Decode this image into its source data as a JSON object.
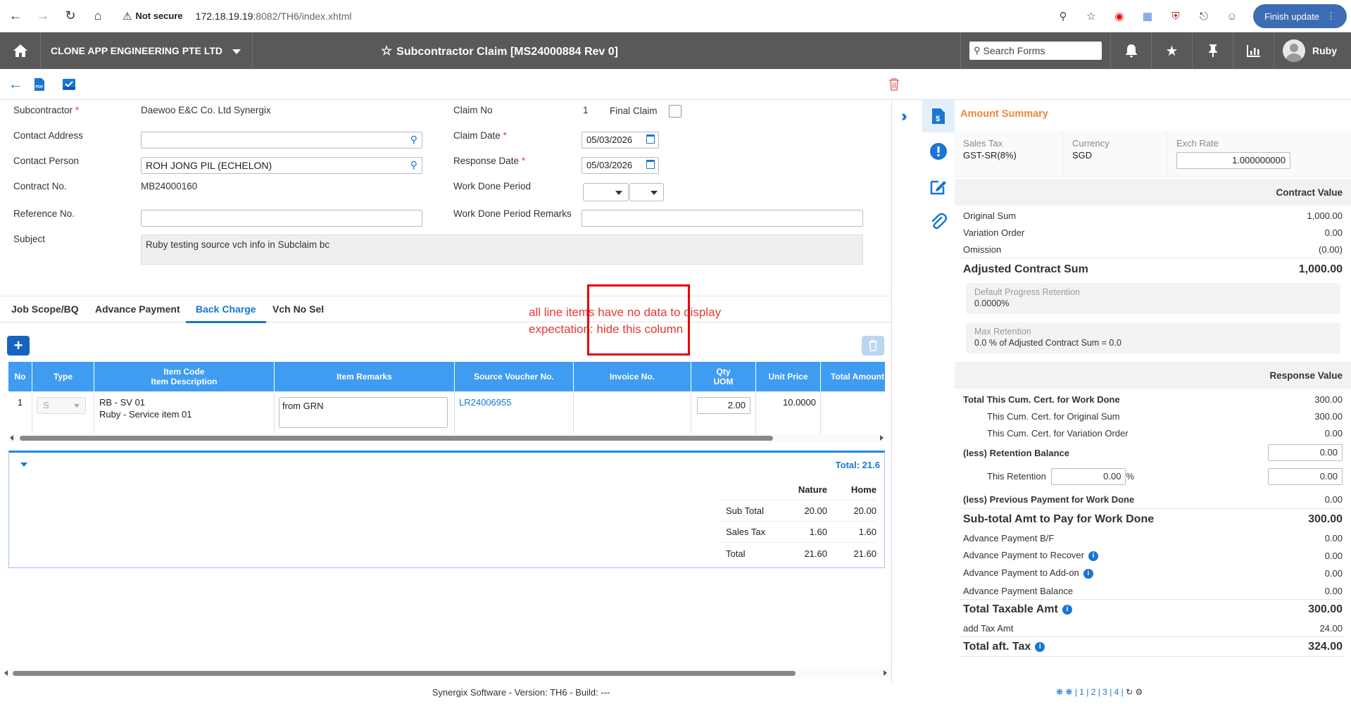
{
  "browser": {
    "security": "Not secure",
    "url_host": "172.18.19.19",
    "url_rest": ":8082/TH6/index.xhtml",
    "finish_update": "Finish update"
  },
  "header": {
    "company": "CLONE APP ENGINEERING PTE LTD",
    "title": "Subcontractor Claim [MS24000884 Rev 0]",
    "search_placeholder": "Search Forms",
    "user": "Ruby"
  },
  "form": {
    "subcontractor_label": "Subcontractor",
    "subcontractor_value": "Daewoo E&C Co. Ltd Synergix",
    "contact_address_label": "Contact Address",
    "contact_address_value": "",
    "contact_person_label": "Contact Person",
    "contact_person_value": "ROH JONG PIL (ECHELON)",
    "contract_no_label": "Contract No.",
    "contract_no_value": "MB24000160",
    "reference_no_label": "Reference No.",
    "reference_no_value": "",
    "subject_label": "Subject",
    "subject_value": "Ruby testing source vch info in Subclaim bc",
    "claim_no_label": "Claim No",
    "claim_no_value": "1",
    "final_claim_label": "Final Claim",
    "claim_date_label": "Claim Date",
    "claim_date_value": "05/03/2026",
    "response_date_label": "Response Date",
    "response_date_value": "05/03/2026",
    "work_done_period_label": "Work Done Period",
    "work_done_remarks_label": "Work Done Period Remarks",
    "required_mark": "*"
  },
  "tabs": [
    {
      "label": "Job Scope/BQ"
    },
    {
      "label": "Advance Payment"
    },
    {
      "label": "Back Charge"
    },
    {
      "label": "Vch No Sel"
    }
  ],
  "annotation": {
    "line1": "all line items have no data to display",
    "line2": "expectation: hide this column"
  },
  "grid": {
    "headers": {
      "no": "No",
      "type": "Type",
      "item_code": "Item Code",
      "item_desc": "Item Description",
      "remarks": "Item Remarks",
      "source_voucher": "Source Voucher No.",
      "invoice": "Invoice No.",
      "qty": "Qty",
      "uom": "UOM",
      "unit_price": "Unit Price",
      "total_amount": "Total Amount"
    },
    "rows": [
      {
        "no": "1",
        "type": "S",
        "item_code": "RB - SV 01",
        "item_desc": "Ruby - Service item 01",
        "remarks": "from GRN",
        "source_voucher": "LR24006955",
        "invoice": "",
        "qty": "2.00",
        "unit_price": "10.0000",
        "total_amount": ""
      }
    ]
  },
  "totals": {
    "total_label": "Total: 21.6",
    "nature_label": "Nature",
    "home_label": "Home",
    "rows": [
      {
        "label": "Sub Total",
        "nature": "20.00",
        "home": "20.00"
      },
      {
        "label": "Sales Tax",
        "nature": "1.60",
        "home": "1.60"
      },
      {
        "label": "Total",
        "nature": "21.60",
        "home": "21.60"
      }
    ]
  },
  "footer": {
    "version": "Synergix Software - Version: TH6 - Build: ---",
    "pages": "| 1 | 2 | 3 | 4 |"
  },
  "summary": {
    "title": "Amount Summary",
    "sales_tax_label": "Sales Tax",
    "sales_tax_value": "GST-SR(8%)",
    "currency_label": "Currency",
    "currency_value": "SGD",
    "exch_rate_label": "Exch Rate",
    "exch_rate_value": "1.000000000",
    "contract_value_head": "Contract Value",
    "original_sum_label": "Original Sum",
    "original_sum_value": "1,000.00",
    "variation_order_label": "Variation Order",
    "variation_order_value": "0.00",
    "omission_label": "Omission",
    "omission_value": "(0.00)",
    "adjusted_label": "Adjusted Contract Sum",
    "adjusted_value": "1,000.00",
    "default_retention_label": "Default Progress Retention",
    "default_retention_value": "0.0000%",
    "max_retention_label": "Max Retention",
    "max_retention_value": "0.0 % of Adjusted Contract Sum = 0.0",
    "response_value_head": "Response Value",
    "total_cum_label": "Total This Cum. Cert. for Work Done",
    "total_cum_value": "300.00",
    "cum_original_label": "This Cum. Cert. for Original Sum",
    "cum_original_value": "300.00",
    "cum_vo_label": "This Cum. Cert. for Variation Order",
    "cum_vo_value": "0.00",
    "retention_balance_label": "(less) Retention Balance",
    "retention_balance_value": "0.00",
    "this_retention_label": "This Retention",
    "this_retention_pct": "0.00",
    "this_retention_pct_sign": "%",
    "this_retention_value": "0.00",
    "prev_payment_label": "(less) Previous Payment for Work Done",
    "prev_payment_value": "0.00",
    "subtotal_label": "Sub-total Amt to Pay for Work Done",
    "subtotal_value": "300.00",
    "adv_bf_label": "Advance Payment B/F",
    "adv_bf_value": "0.00",
    "adv_recover_label": "Advance Payment to Recover",
    "adv_recover_value": "0.00",
    "adv_addon_label": "Advance Payment to Add-on",
    "adv_addon_value": "0.00",
    "adv_balance_label": "Advance Payment Balance",
    "adv_balance_value": "0.00",
    "taxable_label": "Total Taxable Amt",
    "taxable_value": "300.00",
    "add_tax_label": "add Tax Amt",
    "add_tax_value": "24.00",
    "total_aft_tax_label": "Total aft. Tax",
    "total_aft_tax_value": "324.00"
  },
  "colors": {
    "accent": "#1976d2",
    "header_bg": "#595959",
    "grid_header": "#3f9cf0",
    "summary_title": "#f0883a",
    "annotation": "#e53935"
  }
}
